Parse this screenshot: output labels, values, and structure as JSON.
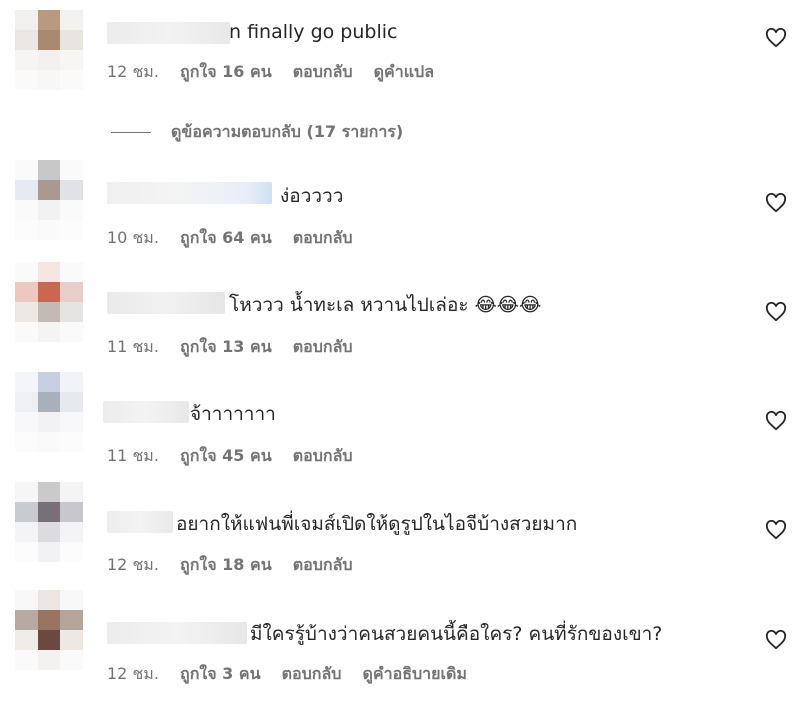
{
  "comments": [
    {
      "text": "n finally go public",
      "time": "12 ชม.",
      "likes": "ถูกใจ 16 คน",
      "reply": "ตอบกลับ",
      "extra": "ดูคำแปล",
      "avatar": [
        "#f2f0ee",
        "#b89a80",
        "#f4f2f0",
        "#e9e6e3",
        "#a78a70",
        "#e8e4e0",
        "#f6f5f4",
        "#f3f1ef",
        "#f7f6f5",
        "#fafafa",
        "#f7f7f7",
        "#fafafa"
      ]
    },
    {
      "text": "ง่อวววว",
      "time": "10 ชม.",
      "likes": "ถูกใจ 64 คน",
      "reply": "ตอบกลับ",
      "extra": "",
      "avatar": [
        "#fafafa",
        "#c8c8c8",
        "#fafafa",
        "#e6eaf2",
        "#a89a92",
        "#e0e2e6",
        "#fafafa",
        "#f2f2f2",
        "#fafafa",
        "#fcfcfc",
        "#fafafa",
        "#fcfcfc"
      ]
    },
    {
      "text": "โหววว น้ำทะเล หวานไปเล่อะ 😂😂😂",
      "time": "11 ชม.",
      "likes": "ถูกใจ 13 คน",
      "reply": "ตอบกลับ",
      "extra": "",
      "avatar": [
        "#fafafa",
        "#f5e6e4",
        "#fafafa",
        "#ecc8c0",
        "#c86850",
        "#e8cec8",
        "#ece8e6",
        "#c2bab6",
        "#e6e4e2",
        "#fafafa",
        "#f4f4f4",
        "#fafafa"
      ]
    },
    {
      "text": "จ้าาาาาาา",
      "time": "11 ชม.",
      "likes": "ถูกใจ 45 คน",
      "reply": "ตอบกลับ",
      "extra": "",
      "avatar": [
        "#f4f5f8",
        "#c8cfe0",
        "#f2f3f6",
        "#eef0f4",
        "#a8b0bc",
        "#e6e9ee",
        "#f8f8fa",
        "#f2f2f4",
        "#f8f8fa",
        "#fcfcfc",
        "#fafafa",
        "#fcfcfc"
      ]
    },
    {
      "text": "อยากให้แฟนพี่เจมส์เปิดให้ดูรูปในไอจีบ้างสวยมาก",
      "time": "12 ชม.",
      "likes": "ถูกใจ 18 คน",
      "reply": "ตอบกลับ",
      "extra": "",
      "avatar": [
        "#f6f6f6",
        "#cacaca",
        "#f4f4f4",
        "#c8cbd0",
        "#787078",
        "#c6c8ce",
        "#f4f4f6",
        "#dcdce0",
        "#f4f4f6",
        "#fcfcfc",
        "#f2f2f4",
        "#fcfcfc"
      ]
    },
    {
      "text": "มีใครรู้บ้างว่าคนสวยคนนี้คือใคร? คนที่รักของเขา?",
      "time": "12 ชม.",
      "likes": "ถูกใจ 3 คน",
      "reply": "ตอบกลับ",
      "extra": "ดูคำอธิบายเดิม",
      "avatar": [
        "#f8f8f8",
        "#ece6e2",
        "#f8f8f8",
        "#b8aaa2",
        "#9a7462",
        "#b4a49a",
        "#f0ece8",
        "#6a4a40",
        "#eee8e4",
        "#fafafa",
        "#f4f2f0",
        "#fafafa"
      ]
    }
  ],
  "view_replies": "ดูข้อความตอบกลับ (17 รายการ)"
}
